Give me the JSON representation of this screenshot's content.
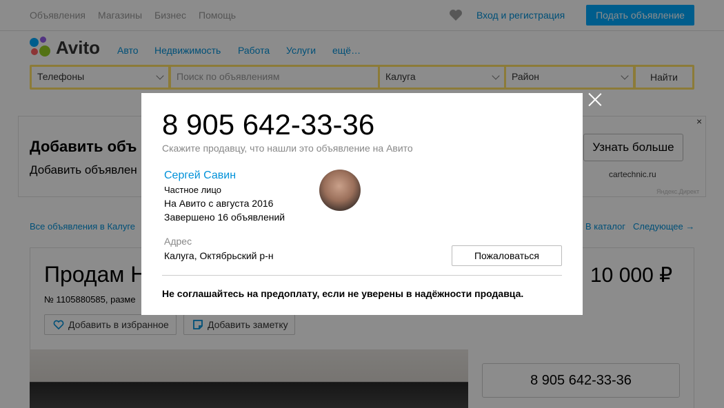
{
  "topbar": {
    "nav": [
      "Объявления",
      "Магазины",
      "Бизнес",
      "Помощь"
    ],
    "login": "Вход и регистрация",
    "post_button": "Подать объявление"
  },
  "logo": {
    "text": "Avito"
  },
  "categories": [
    "Авто",
    "Недвижимость",
    "Работа",
    "Услуги",
    "ещё…"
  ],
  "search": {
    "category": "Телефоны",
    "placeholder": "Поиск по объявлениям",
    "city": "Калуга",
    "district": "Район",
    "submit": "Найти"
  },
  "ad": {
    "title": "Добавить объ",
    "description": "Добавить объявлен",
    "button": "Узнать больше",
    "domain": "cartechnic.ru",
    "source": "Яндекс.Директ",
    "close": "×"
  },
  "breadcrumbs": {
    "all": "Все объявления в Калуге",
    "catalog": "В каталог",
    "next": "Следующее →"
  },
  "listing": {
    "title": "Продам Н",
    "price": "10 000 ₽",
    "meta": "№ 1105880585, разме",
    "favorite": "Добавить в избранное",
    "note": "Добавить заметку",
    "phone": "8 905 642-33-36"
  },
  "modal": {
    "phone": "8 905 642-33-36",
    "hint": "Скажите продавцу, что нашли это объявление на Авито",
    "seller_name": "Сергей Савин",
    "seller_type": "Частное лицо",
    "since": "На Авито с августа 2016",
    "completed": "Завершено 16 объявлений",
    "address_label": "Адрес",
    "address": "Калуга, Октябрьский р-н",
    "report_button": "Пожаловаться",
    "warning": "Не соглашайтесь на предоплату, если не уверены в надёжности продавца."
  },
  "colors": {
    "accent": "#0091d9",
    "post_button": "#00aaff",
    "search_frame": "#ffe066",
    "overlay": "rgba(0,0,0,0.45)"
  }
}
